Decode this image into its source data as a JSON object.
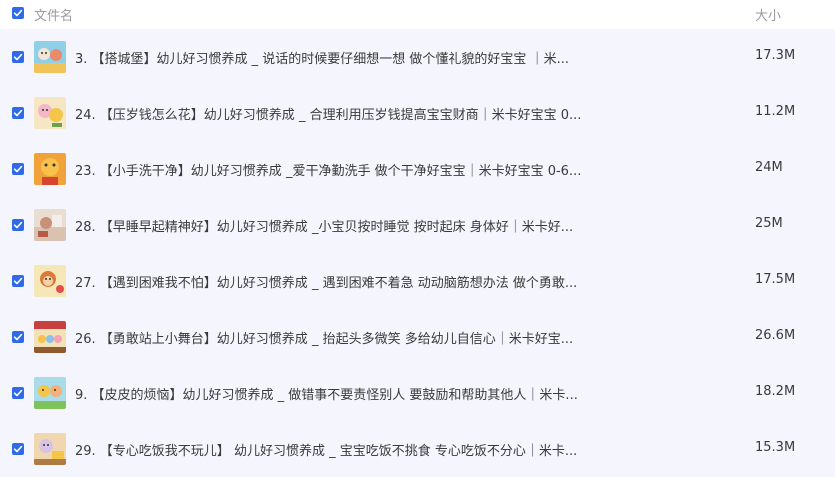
{
  "header": {
    "name_label": "文件名",
    "size_label": "大小"
  },
  "colors": {
    "accent": "#2f6be8",
    "row_bg": "#f4f5fd",
    "header_text": "#9a9aa0"
  },
  "files": [
    {
      "name": "3. 【搭城堡】幼儿好习惯养成 _ 说话的时候要仔细想一想 做个懂礼貌的好宝宝 ｜米...",
      "size": "17.3M",
      "checked": true
    },
    {
      "name": "24. 【压岁钱怎么花】幼儿好习惯养成 _ 合理利用压岁钱提高宝宝财商｜米卡好宝宝 0...",
      "size": "11.2M",
      "checked": true
    },
    {
      "name": "23. 【小手洗干净】幼儿好习惯养成 _爱干净勤洗手 做个干净好宝宝｜米卡好宝宝 0-6...",
      "size": "24M",
      "checked": true
    },
    {
      "name": "28. 【早睡早起精神好】幼儿好习惯养成 _小宝贝按时睡觉 按时起床 身体好｜米卡好...",
      "size": "25M",
      "checked": true
    },
    {
      "name": "27. 【遇到困难我不怕】幼儿好习惯养成 _ 遇到困难不着急 动动脑筋想办法 做个勇敢...",
      "size": "17.5M",
      "checked": true
    },
    {
      "name": "26. 【勇敢站上小舞台】幼儿好习惯养成 _ 抬起头多微笑 多给幼儿自信心｜米卡好宝...",
      "size": "26.6M",
      "checked": true
    },
    {
      "name": "9. 【皮皮的烦恼】幼儿好习惯养成 _ 做错事不要责怪别人 要鼓励和帮助其他人｜米卡...",
      "size": "18.2M",
      "checked": true
    },
    {
      "name": "29. 【专心吃饭我不玩儿】 幼儿好习惯养成 _ 宝宝吃饭不挑食 专心吃饭不分心｜米卡...",
      "size": "15.3M",
      "checked": true
    }
  ]
}
